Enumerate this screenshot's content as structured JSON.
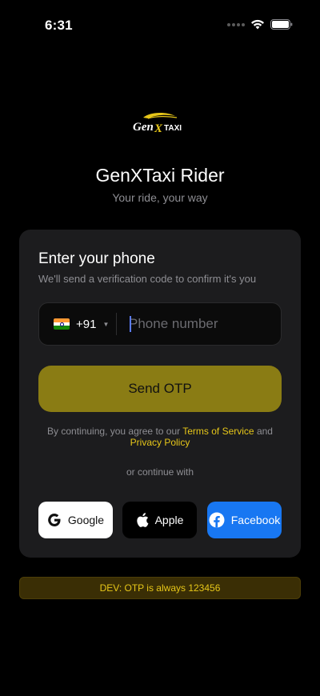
{
  "status_bar": {
    "time": "6:31"
  },
  "logo": {
    "brand_text_left": "Gen",
    "brand_text_x": "X",
    "brand_text_right": "TAXI"
  },
  "header": {
    "title": "GenXTaxi Rider",
    "subtitle": "Your ride, your way"
  },
  "phone_card": {
    "title": "Enter your phone",
    "subtitle": "We'll send a verification code to confirm it's you",
    "country_code": "+91",
    "phone_placeholder": "Phone number",
    "phone_value": "",
    "send_label": "Send OTP",
    "terms_prefix": "By continuing, you agree to our",
    "terms_link": "Terms of Service",
    "terms_and": "and",
    "privacy_link": "Privacy Policy",
    "or_label": "or continue with"
  },
  "social": {
    "google_label": "Google",
    "apple_label": "Apple",
    "facebook_label": "Facebook"
  },
  "dev_banner": {
    "text": "DEV: OTP is always 123456"
  },
  "colors": {
    "background": "#000000",
    "card": "#1c1c1e",
    "accent": "#8a7c14",
    "link": "#e6c619",
    "facebook": "#1877f2"
  },
  "icons": [
    "wifi-icon",
    "battery-icon",
    "india-flag-icon",
    "google-icon",
    "apple-icon",
    "facebook-icon"
  ]
}
